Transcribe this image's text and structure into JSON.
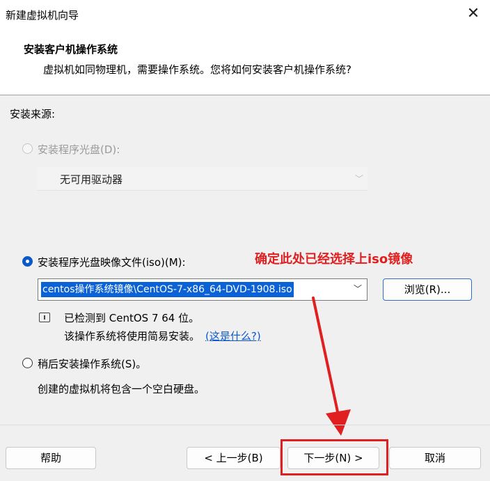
{
  "window": {
    "title": "新建虚拟机向导",
    "close_glyph": "✕"
  },
  "header": {
    "title": "安装客户机操作系统",
    "subtitle": "虚拟机如同物理机，需要操作系统。您将如何安装客户机操作系统?"
  },
  "source": {
    "label": "安装来源:",
    "disc": {
      "label": "安装程序光盘(D):",
      "selected": false,
      "enabled": false,
      "combo_value": "无可用驱动器"
    },
    "iso": {
      "label": "安装程序光盘映像文件(iso)(M):",
      "selected": true,
      "combo_value": "centos操作系统镜像\\CentOS-7-x86_64-DVD-1908.iso",
      "browse_label": "浏览(R)..."
    },
    "detect": {
      "line1": "已检测到 CentOS 7 64 位。",
      "line2": "该操作系统将使用简易安装。",
      "link": "(这是什么?)"
    },
    "later": {
      "label": "稍后安装操作系统(S)。",
      "selected": false,
      "note": "创建的虚拟机将包含一个空白硬盘。"
    }
  },
  "annotation": {
    "text": "确定此处已经选择上iso镜像",
    "color": "#e02020"
  },
  "footer": {
    "help": "帮助",
    "back": "< 上一步(B)",
    "next": "下一步(N) >",
    "cancel": "取消"
  },
  "colors": {
    "accent": "#0a59c9",
    "selection": "#0a62d6",
    "annotation": "#e02020"
  }
}
